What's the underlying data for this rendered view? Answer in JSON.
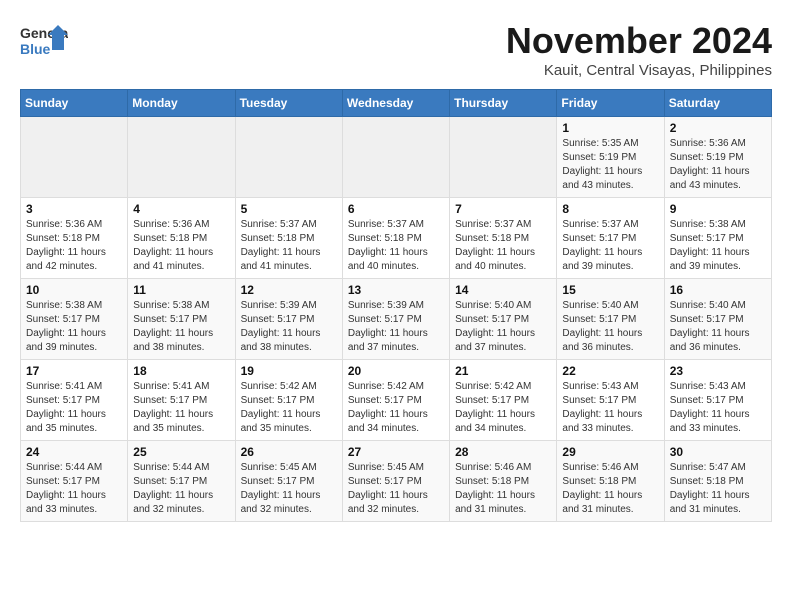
{
  "header": {
    "logo_general": "General",
    "logo_blue": "Blue",
    "month": "November 2024",
    "location": "Kauit, Central Visayas, Philippines"
  },
  "weekdays": [
    "Sunday",
    "Monday",
    "Tuesday",
    "Wednesday",
    "Thursday",
    "Friday",
    "Saturday"
  ],
  "weeks": [
    [
      {
        "day": "",
        "empty": true
      },
      {
        "day": "",
        "empty": true
      },
      {
        "day": "",
        "empty": true
      },
      {
        "day": "",
        "empty": true
      },
      {
        "day": "",
        "empty": true
      },
      {
        "day": "1",
        "sunrise": "Sunrise: 5:35 AM",
        "sunset": "Sunset: 5:19 PM",
        "daylight": "Daylight: 11 hours and 43 minutes."
      },
      {
        "day": "2",
        "sunrise": "Sunrise: 5:36 AM",
        "sunset": "Sunset: 5:19 PM",
        "daylight": "Daylight: 11 hours and 43 minutes."
      }
    ],
    [
      {
        "day": "3",
        "sunrise": "Sunrise: 5:36 AM",
        "sunset": "Sunset: 5:18 PM",
        "daylight": "Daylight: 11 hours and 42 minutes."
      },
      {
        "day": "4",
        "sunrise": "Sunrise: 5:36 AM",
        "sunset": "Sunset: 5:18 PM",
        "daylight": "Daylight: 11 hours and 41 minutes."
      },
      {
        "day": "5",
        "sunrise": "Sunrise: 5:37 AM",
        "sunset": "Sunset: 5:18 PM",
        "daylight": "Daylight: 11 hours and 41 minutes."
      },
      {
        "day": "6",
        "sunrise": "Sunrise: 5:37 AM",
        "sunset": "Sunset: 5:18 PM",
        "daylight": "Daylight: 11 hours and 40 minutes."
      },
      {
        "day": "7",
        "sunrise": "Sunrise: 5:37 AM",
        "sunset": "Sunset: 5:18 PM",
        "daylight": "Daylight: 11 hours and 40 minutes."
      },
      {
        "day": "8",
        "sunrise": "Sunrise: 5:37 AM",
        "sunset": "Sunset: 5:17 PM",
        "daylight": "Daylight: 11 hours and 39 minutes."
      },
      {
        "day": "9",
        "sunrise": "Sunrise: 5:38 AM",
        "sunset": "Sunset: 5:17 PM",
        "daylight": "Daylight: 11 hours and 39 minutes."
      }
    ],
    [
      {
        "day": "10",
        "sunrise": "Sunrise: 5:38 AM",
        "sunset": "Sunset: 5:17 PM",
        "daylight": "Daylight: 11 hours and 39 minutes."
      },
      {
        "day": "11",
        "sunrise": "Sunrise: 5:38 AM",
        "sunset": "Sunset: 5:17 PM",
        "daylight": "Daylight: 11 hours and 38 minutes."
      },
      {
        "day": "12",
        "sunrise": "Sunrise: 5:39 AM",
        "sunset": "Sunset: 5:17 PM",
        "daylight": "Daylight: 11 hours and 38 minutes."
      },
      {
        "day": "13",
        "sunrise": "Sunrise: 5:39 AM",
        "sunset": "Sunset: 5:17 PM",
        "daylight": "Daylight: 11 hours and 37 minutes."
      },
      {
        "day": "14",
        "sunrise": "Sunrise: 5:40 AM",
        "sunset": "Sunset: 5:17 PM",
        "daylight": "Daylight: 11 hours and 37 minutes."
      },
      {
        "day": "15",
        "sunrise": "Sunrise: 5:40 AM",
        "sunset": "Sunset: 5:17 PM",
        "daylight": "Daylight: 11 hours and 36 minutes."
      },
      {
        "day": "16",
        "sunrise": "Sunrise: 5:40 AM",
        "sunset": "Sunset: 5:17 PM",
        "daylight": "Daylight: 11 hours and 36 minutes."
      }
    ],
    [
      {
        "day": "17",
        "sunrise": "Sunrise: 5:41 AM",
        "sunset": "Sunset: 5:17 PM",
        "daylight": "Daylight: 11 hours and 35 minutes."
      },
      {
        "day": "18",
        "sunrise": "Sunrise: 5:41 AM",
        "sunset": "Sunset: 5:17 PM",
        "daylight": "Daylight: 11 hours and 35 minutes."
      },
      {
        "day": "19",
        "sunrise": "Sunrise: 5:42 AM",
        "sunset": "Sunset: 5:17 PM",
        "daylight": "Daylight: 11 hours and 35 minutes."
      },
      {
        "day": "20",
        "sunrise": "Sunrise: 5:42 AM",
        "sunset": "Sunset: 5:17 PM",
        "daylight": "Daylight: 11 hours and 34 minutes."
      },
      {
        "day": "21",
        "sunrise": "Sunrise: 5:42 AM",
        "sunset": "Sunset: 5:17 PM",
        "daylight": "Daylight: 11 hours and 34 minutes."
      },
      {
        "day": "22",
        "sunrise": "Sunrise: 5:43 AM",
        "sunset": "Sunset: 5:17 PM",
        "daylight": "Daylight: 11 hours and 33 minutes."
      },
      {
        "day": "23",
        "sunrise": "Sunrise: 5:43 AM",
        "sunset": "Sunset: 5:17 PM",
        "daylight": "Daylight: 11 hours and 33 minutes."
      }
    ],
    [
      {
        "day": "24",
        "sunrise": "Sunrise: 5:44 AM",
        "sunset": "Sunset: 5:17 PM",
        "daylight": "Daylight: 11 hours and 33 minutes."
      },
      {
        "day": "25",
        "sunrise": "Sunrise: 5:44 AM",
        "sunset": "Sunset: 5:17 PM",
        "daylight": "Daylight: 11 hours and 32 minutes."
      },
      {
        "day": "26",
        "sunrise": "Sunrise: 5:45 AM",
        "sunset": "Sunset: 5:17 PM",
        "daylight": "Daylight: 11 hours and 32 minutes."
      },
      {
        "day": "27",
        "sunrise": "Sunrise: 5:45 AM",
        "sunset": "Sunset: 5:17 PM",
        "daylight": "Daylight: 11 hours and 32 minutes."
      },
      {
        "day": "28",
        "sunrise": "Sunrise: 5:46 AM",
        "sunset": "Sunset: 5:18 PM",
        "daylight": "Daylight: 11 hours and 31 minutes."
      },
      {
        "day": "29",
        "sunrise": "Sunrise: 5:46 AM",
        "sunset": "Sunset: 5:18 PM",
        "daylight": "Daylight: 11 hours and 31 minutes."
      },
      {
        "day": "30",
        "sunrise": "Sunrise: 5:47 AM",
        "sunset": "Sunset: 5:18 PM",
        "daylight": "Daylight: 11 hours and 31 minutes."
      }
    ]
  ],
  "colors": {
    "header_bg": "#3a7abf",
    "odd_row_bg": "#f5f5f5",
    "even_row_bg": "#ffffff",
    "empty_bg": "#efefef"
  }
}
